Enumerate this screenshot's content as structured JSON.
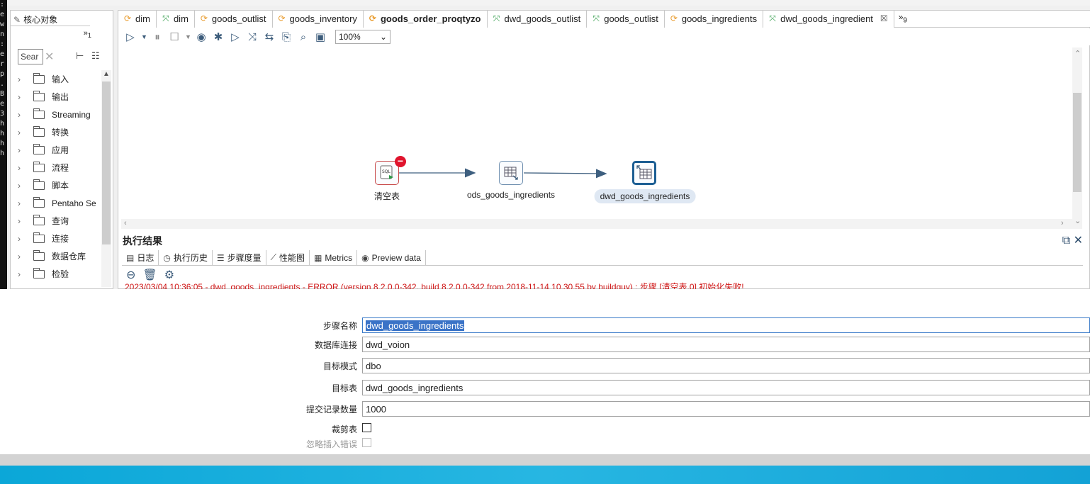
{
  "left_panel": {
    "tab_label": "核心对象",
    "more_label": "»",
    "more_count": "1",
    "search_placeholder": "Sear",
    "tree_items": [
      "输入",
      "输出",
      "Streaming",
      "转换",
      "应用",
      "流程",
      "脚本",
      "Pentaho Se",
      "查询",
      "连接",
      "数据仓库",
      "检验"
    ]
  },
  "editor": {
    "tabs": [
      {
        "label": "dim",
        "icon": "transformation-icon",
        "color": "#e89a2a"
      },
      {
        "label": "dim",
        "icon": "job-icon",
        "color": "#2e9a47"
      },
      {
        "label": "goods_outlist",
        "icon": "transformation-icon",
        "color": "#e89a2a"
      },
      {
        "label": "goods_inventory",
        "icon": "transformation-icon",
        "color": "#e89a2a"
      },
      {
        "label": "goods_order_proqtyzo",
        "icon": "transformation-icon",
        "color": "#e89a2a"
      },
      {
        "label": "dwd_goods_outlist",
        "icon": "job-icon",
        "color": "#2e9a47"
      },
      {
        "label": "goods_outlist",
        "icon": "job-icon",
        "color": "#2e9a47"
      },
      {
        "label": "goods_ingredients",
        "icon": "transformation-icon",
        "color": "#e89a2a"
      },
      {
        "label": "dwd_goods_ingredient",
        "icon": "job-icon",
        "color": "#2e9a47"
      }
    ],
    "tab_overflow_label": "»",
    "tab_overflow_count": "9",
    "zoom": "100%",
    "nodes": [
      {
        "label": "清空表"
      },
      {
        "label": "ods_goods_ingredients"
      },
      {
        "label": "dwd_goods_ingredients"
      }
    ]
  },
  "exec": {
    "title": "执行结果",
    "tabs": [
      "日志",
      "执行历史",
      "步骤度量",
      "性能图",
      "Metrics",
      "Preview data"
    ],
    "log_line": "2023/03/04 10:36:05 - dwd_goods_ingredients - ERROR (version 8.2.0.0-342, build 8.2.0.0-342 from 2018-11-14 10.30.55 by buildguy) : 步骤 [清空表.0] 初始化失败!"
  },
  "dialog": {
    "step_name_label": "步骤名称",
    "step_name_value": "dwd_goods_ingredients",
    "db_conn_label": "数据库连接",
    "db_conn_value": "dwd_voion",
    "schema_label": "目标模式",
    "schema_value": "dbo",
    "table_label": "目标表",
    "table_value": "dwd_goods_ingredients",
    "commit_label": "提交记录数量",
    "commit_value": "1000",
    "truncate_label": "裁剪表",
    "ignore_label": "忽略插入错误"
  },
  "colors": {
    "accent": "#1d5f94",
    "error": "#d01818",
    "taskbar": "#13a2d6"
  }
}
